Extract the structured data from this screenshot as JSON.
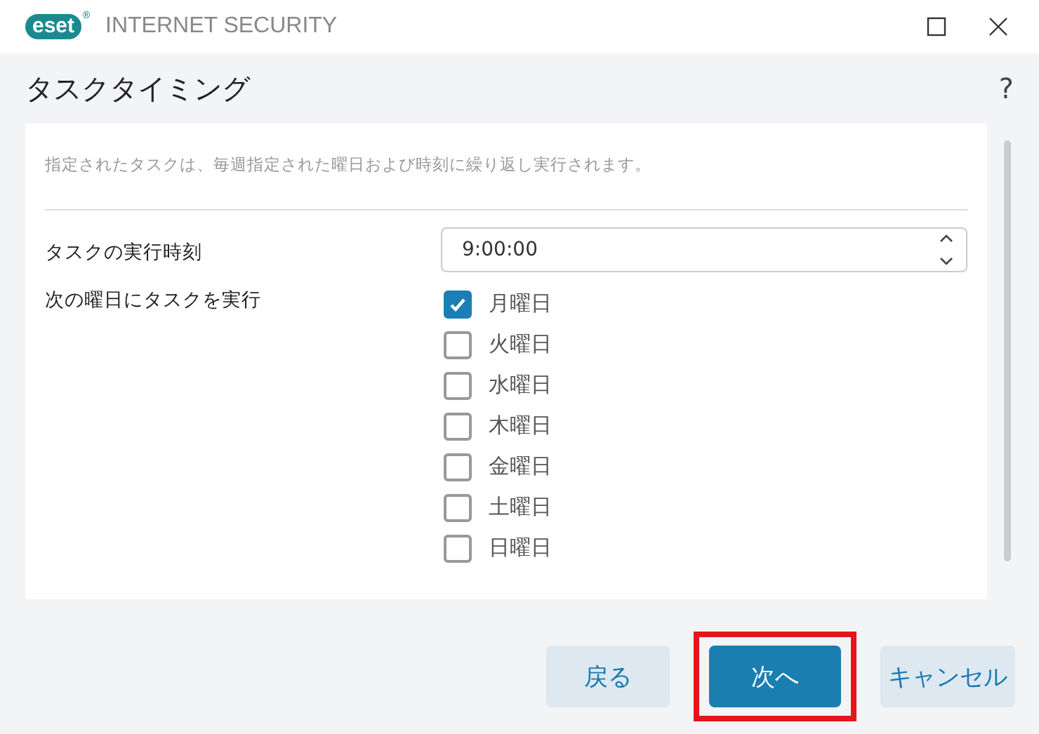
{
  "window": {
    "logo": "eset",
    "logo_mark": "®",
    "title": "INTERNET SECURITY"
  },
  "header": {
    "title": "タスクタイミング",
    "help": "?"
  },
  "panel": {
    "description": "指定されたタスクは、毎週指定された曜日および時刻に繰り返し実行されます。",
    "time_label": "タスクの実行時刻",
    "time_value": "9:00:00",
    "days_label": "次の曜日にタスクを実行",
    "days": [
      {
        "label": "月曜日",
        "checked": true
      },
      {
        "label": "火曜日",
        "checked": false
      },
      {
        "label": "水曜日",
        "checked": false
      },
      {
        "label": "木曜日",
        "checked": false
      },
      {
        "label": "金曜日",
        "checked": false
      },
      {
        "label": "土曜日",
        "checked": false
      },
      {
        "label": "日曜日",
        "checked": false
      }
    ]
  },
  "buttons": [
    {
      "label": "戻る",
      "kind": "secondary",
      "highlighted": false
    },
    {
      "label": "次へ",
      "kind": "primary",
      "highlighted": true
    },
    {
      "label": "キャンセル",
      "kind": "secondary",
      "highlighted": false
    }
  ]
}
